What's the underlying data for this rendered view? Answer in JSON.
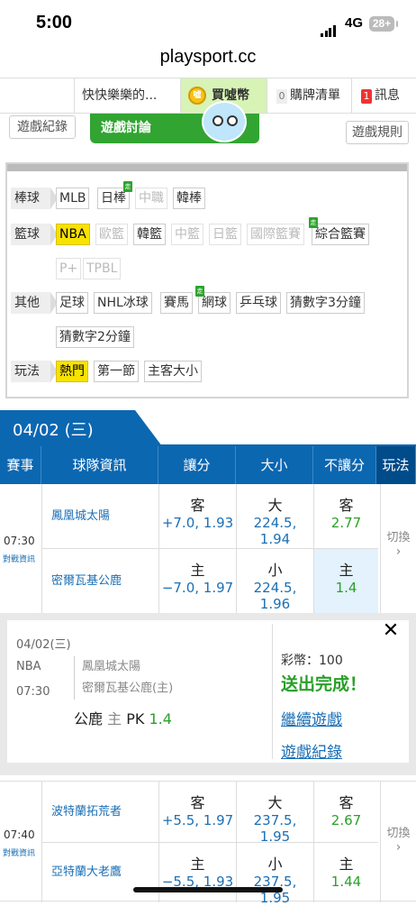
{
  "status_bar": {
    "time": "5:00",
    "network": "4G",
    "battery": "28+"
  },
  "browser": {
    "url": "playsport.cc"
  },
  "top_nav": {
    "user": "快快樂樂的...",
    "buy_coins": "買噓幣",
    "coin_icon_text": "噓",
    "cart_count": "0",
    "cart": "購牌清單",
    "msg_count": "1",
    "messages": "訊息"
  },
  "actions": {
    "history": "遊戲紀錄",
    "discuss": "遊戲討論",
    "rules": "遊戲規則"
  },
  "filters": {
    "baseball": {
      "label": "棒球",
      "items": [
        "MLB",
        "日棒",
        "中職",
        "韓棒"
      ]
    },
    "basketball": {
      "label": "籃球",
      "items": [
        "NBA",
        "歐籃",
        "韓籃",
        "中籃",
        "日籃",
        "國際籃賽",
        "綜合籃賽",
        "P+",
        "TPBL"
      ]
    },
    "other": {
      "label": "其他",
      "items": [
        "足球",
        "NHL冰球",
        "賽馬",
        "網球",
        "乒乓球",
        "猜數字3分鐘",
        "猜數字2分鐘"
      ]
    },
    "play": {
      "label": "玩法",
      "items": [
        "熱門",
        "第一節",
        "主客大小"
      ]
    },
    "tag_zou": "走"
  },
  "date": {
    "label": "04/02 (三)"
  },
  "table_header": {
    "event": "賽事",
    "teams": "球隊資訊",
    "spread": "讓分",
    "total": "大小",
    "moneyline": "不讓分",
    "play": "玩法"
  },
  "games": [
    {
      "time": "07:30",
      "vs_label": "對戰資訊",
      "away": "鳳凰城太陽",
      "home": "密爾瓦基公鹿",
      "away_spread": {
        "label": "客",
        "value": "+7.0, 1.93"
      },
      "home_spread": {
        "label": "主",
        "value": "−7.0, 1.97"
      },
      "over": {
        "label": "大",
        "value": "224.5, 1.94"
      },
      "under": {
        "label": "小",
        "value": "224.5, 1.96"
      },
      "away_ml": {
        "label": "客",
        "value": "2.77"
      },
      "home_ml": {
        "label": "主",
        "value": "1.4"
      },
      "switch": "切換"
    },
    {
      "time": "07:40",
      "vs_label": "對戰資訊",
      "away": "波特蘭拓荒者",
      "home": "亞特蘭大老鷹",
      "away_spread": {
        "label": "客",
        "value": "+5.5, 1.97"
      },
      "home_spread": {
        "label": "主",
        "value": "−5.5, 1.93"
      },
      "over": {
        "label": "大",
        "value": "237.5, 1.95"
      },
      "under": {
        "label": "小",
        "value": "237.5, 1.95"
      },
      "away_ml": {
        "label": "客",
        "value": "2.67"
      },
      "home_ml": {
        "label": "主",
        "value": "1.44"
      },
      "switch": "切換"
    }
  ],
  "popup": {
    "date": "04/02(三)",
    "league": "NBA",
    "time": "07:30",
    "away": "鳳凰城太陽",
    "home": "密爾瓦基公鹿(主)",
    "pick_team": "公鹿",
    "pick_side": "主",
    "pick_type": "PK",
    "pick_odds": "1.4",
    "coins": "彩幣：100",
    "success": "送出完成！",
    "continue": "繼續遊戲",
    "history": "遊戲紀錄",
    "close": "✕"
  },
  "colors": {
    "brand_blue": "#0c67b1",
    "green": "#2aa02a",
    "highlight": "#f7e200",
    "selected_cell": "#e3f2fc"
  }
}
